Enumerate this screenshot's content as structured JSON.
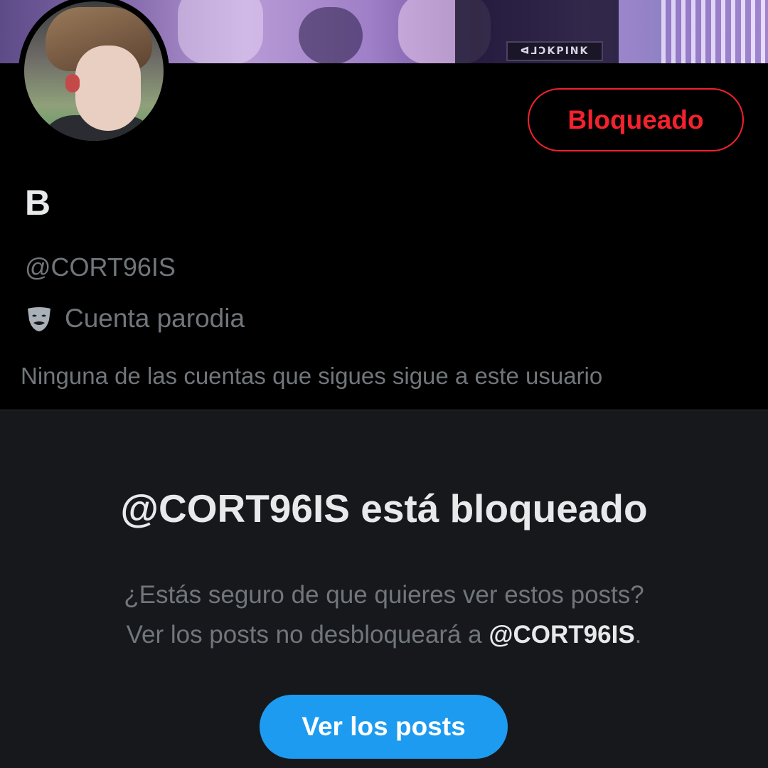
{
  "banner": {
    "tag_text": "ᐊ⅃ƆKPINK"
  },
  "header": {
    "blocked_button_label": "Bloqueado"
  },
  "profile": {
    "display_name": "B",
    "handle": "@CORT96IS",
    "parody_label": "Cuenta parodia",
    "parody_icon": "theater-mask-icon",
    "followers_note": "Ninguna de las cuentas que sigues sigue a este usuario"
  },
  "blocked_panel": {
    "title": "@CORT96IS está bloqueado",
    "desc_line1": "¿Estás seguro de que quieres ver estos posts?",
    "desc_line2_prefix": "Ver los posts no desbloqueará a ",
    "desc_line2_handle": "@CORT96IS",
    "desc_line2_suffix": ".",
    "view_posts_label": "Ver los posts"
  },
  "colors": {
    "accent_blue": "#1d9bf0",
    "blocked_red": "#f4212e",
    "text_primary": "#e7e9ea",
    "text_secondary": "#71767b"
  }
}
